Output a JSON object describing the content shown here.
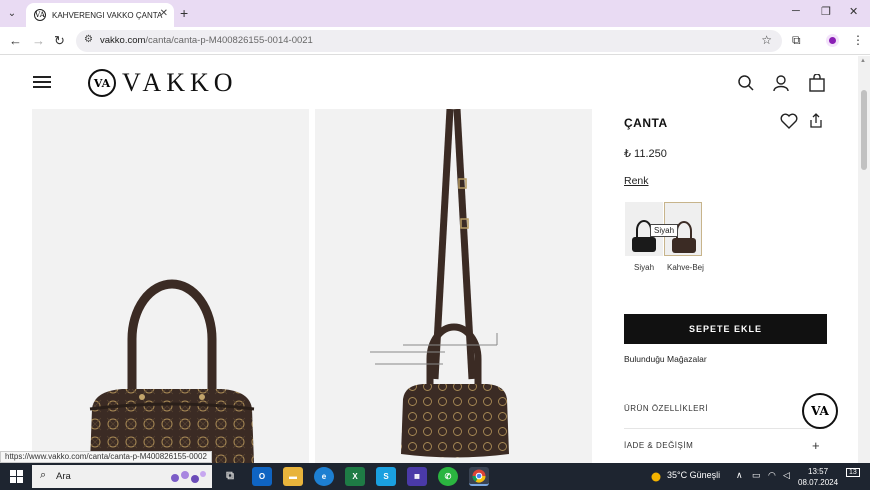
{
  "browser": {
    "tab_title": "KAHVERENGI VAKKO ÇANTA",
    "tab_favicon": "VA",
    "url_host": "vakko.com",
    "url_path": "/canta/canta-p-M400826155-0014-0021",
    "status_url": "https://www.vakko.com/canta/canta-p-M400826155-0002"
  },
  "site": {
    "logo_monogram": "VA",
    "logo_text": "VAKKO"
  },
  "product": {
    "title": "ÇANTA",
    "price": "₺ 11.250",
    "color_label": "Renk",
    "colors": [
      {
        "name": "Siyah",
        "hex": "#1a1a1a"
      },
      {
        "name": "Kahve-Bej",
        "hex": "#3b2b24"
      }
    ],
    "tooltip": "Siyah",
    "add_to_cart": "SEPETE EKLE",
    "stores_link": "Bulunduğu Mağazalar",
    "accordion": [
      {
        "label": "ÜRÜN ÖZELLİKLERİ"
      },
      {
        "label": "İADE & DEĞİŞİM"
      }
    ],
    "chat_monogram": "VA"
  },
  "taskbar": {
    "search_text": "Ara",
    "weather": "35°C  Güneşli",
    "time": "13:57",
    "date": "08.07.2024",
    "notifications": "13"
  },
  "colors": {
    "tabbar_bg": "#e9dbf3",
    "bag_brown": "#3b2b24",
    "button_black": "#111111",
    "taskbar_bg": "#1e2530"
  }
}
